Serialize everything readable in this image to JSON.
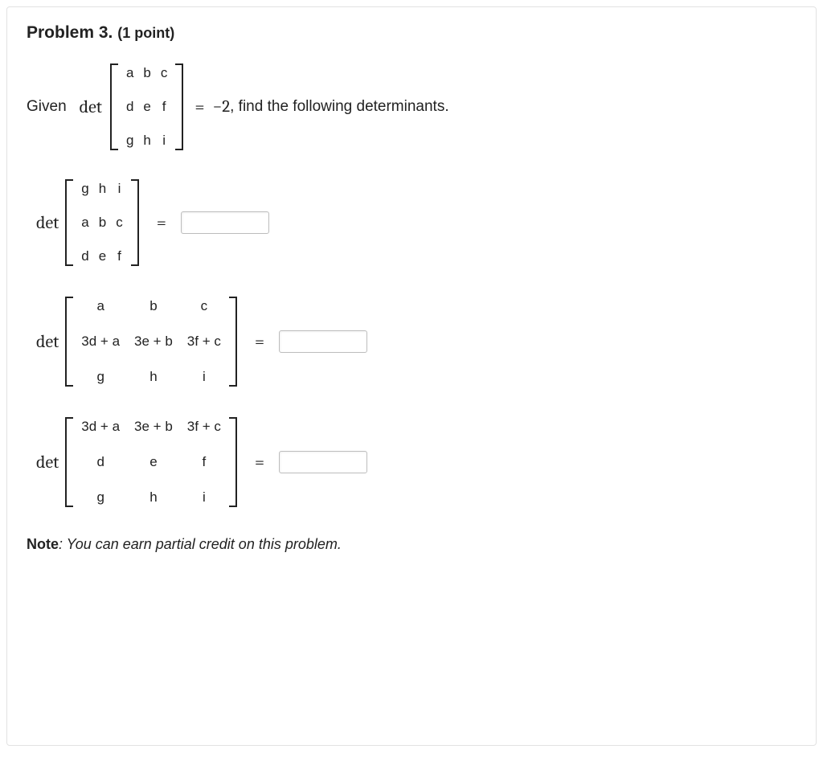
{
  "title": {
    "label": "Problem 3.",
    "points": "(1 point)"
  },
  "given": {
    "prefix": "Given",
    "det": "det",
    "eq": "=",
    "value": "−2",
    "suffix": ", find the following determinants.",
    "matrix": [
      [
        "a",
        "b",
        "c"
      ],
      [
        "d",
        "e",
        "f"
      ],
      [
        "g",
        "h",
        "i"
      ]
    ]
  },
  "parts": [
    {
      "det": "det",
      "eq": "=",
      "matrix": [
        [
          "g",
          "h",
          "i"
        ],
        [
          "a",
          "b",
          "c"
        ],
        [
          "d",
          "e",
          "f"
        ]
      ],
      "answer": ""
    },
    {
      "det": "det",
      "eq": "=",
      "matrix": [
        [
          "a",
          "b",
          "c"
        ],
        [
          "3d + a",
          "3e + b",
          "3f + c"
        ],
        [
          "g",
          "h",
          "i"
        ]
      ],
      "answer": ""
    },
    {
      "det": "det",
      "eq": "=",
      "matrix": [
        [
          "3d + a",
          "3e + b",
          "3f + c"
        ],
        [
          "d",
          "e",
          "f"
        ],
        [
          "g",
          "h",
          "i"
        ]
      ],
      "answer": ""
    }
  ],
  "note": {
    "label": "Note",
    "text": ": You can earn partial credit on this problem."
  }
}
